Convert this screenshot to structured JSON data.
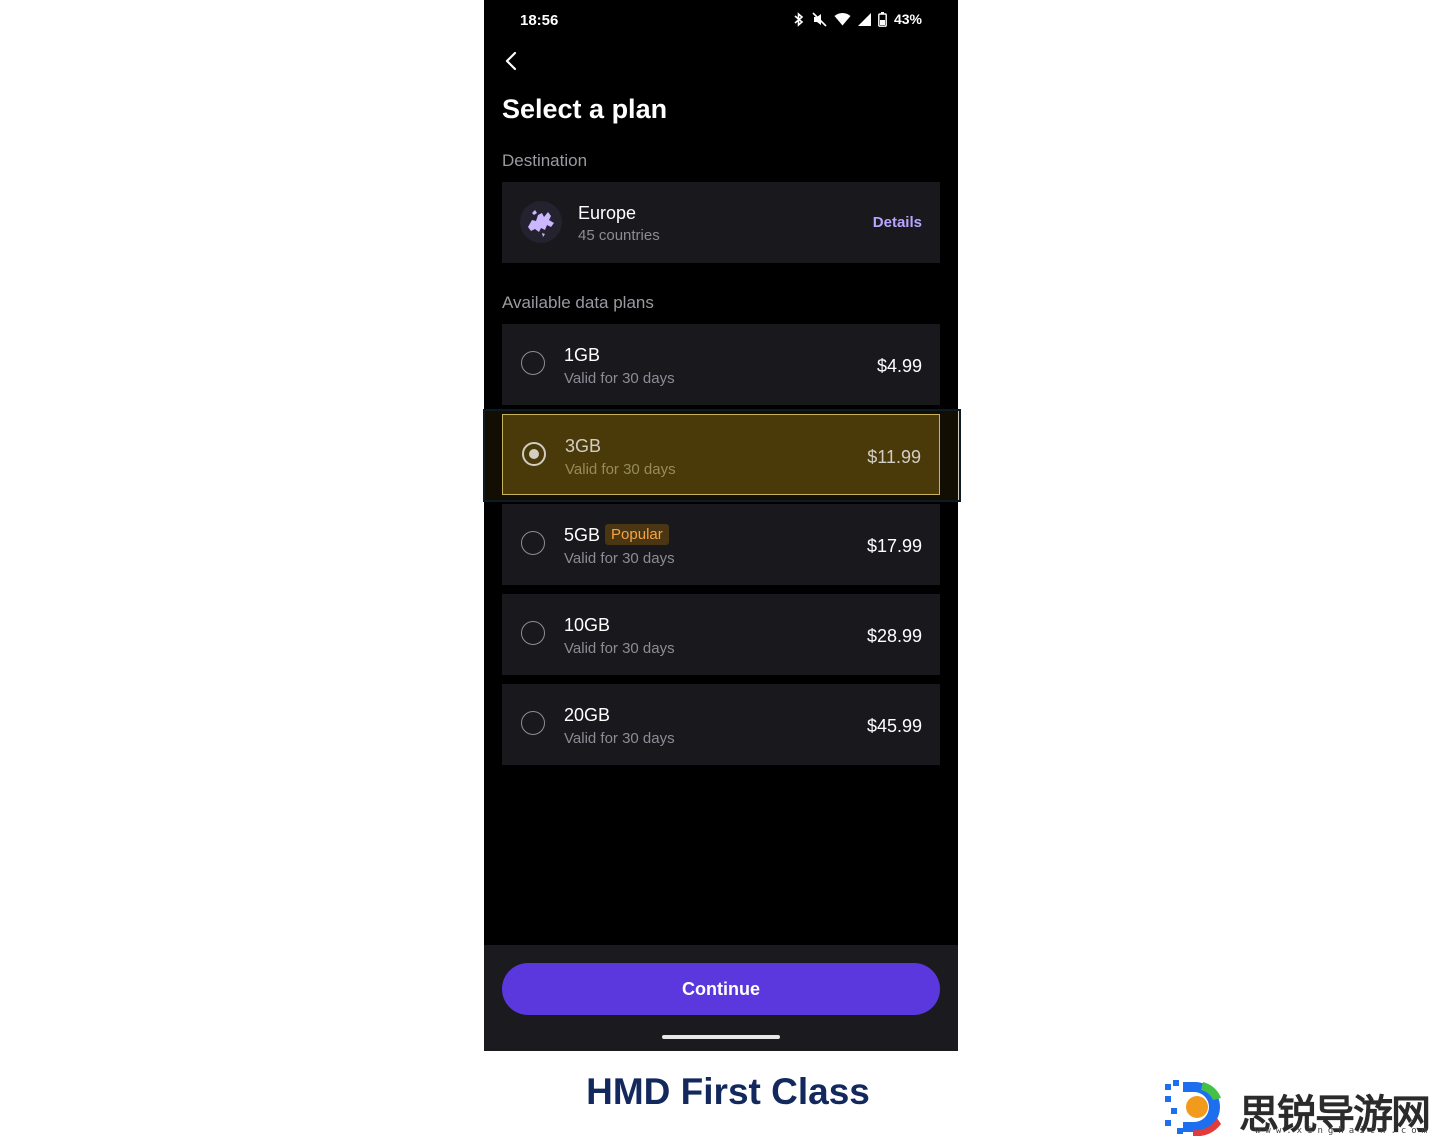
{
  "status_bar": {
    "time": "18:56",
    "battery": "43%"
  },
  "header": {
    "title": "Select a plan"
  },
  "destination": {
    "section_label": "Destination",
    "name": "Europe",
    "subtitle": "45 countries",
    "details_label": "Details"
  },
  "plans": {
    "section_label": "Available data plans",
    "selected_index": 1,
    "items": [
      {
        "name": "1GB",
        "validity": "Valid for 30 days",
        "price": "$4.99"
      },
      {
        "name": "3GB",
        "validity": "Valid for 30 days",
        "price": "$11.99"
      },
      {
        "name": "5GB",
        "badge": "Popular",
        "validity": "Valid for 30 days",
        "price": "$17.99"
      },
      {
        "name": "10GB",
        "validity": "Valid for 30 days",
        "price": "$28.99"
      },
      {
        "name": "20GB",
        "validity": "Valid for 30 days",
        "price": "$45.99"
      }
    ]
  },
  "footer": {
    "continue_label": "Continue"
  },
  "caption": "HMD First Class",
  "watermark": {
    "text": "思锐导游网",
    "url": "www.xinghaicn.com"
  },
  "colors": {
    "background": "#000000",
    "card": "#18181d",
    "accent": "#5b38dd",
    "selected_fill": "#4b3a08",
    "selected_border": "#f2dc78",
    "link": "#b9a5ff",
    "badge_text": "#f5a440",
    "caption": "#13295e"
  },
  "icons": [
    "bluetooth-icon",
    "mute-icon",
    "wifi-icon",
    "signal-icon",
    "battery-icon",
    "back-arrow-icon",
    "europe-map-icon",
    "radio-icon"
  ]
}
